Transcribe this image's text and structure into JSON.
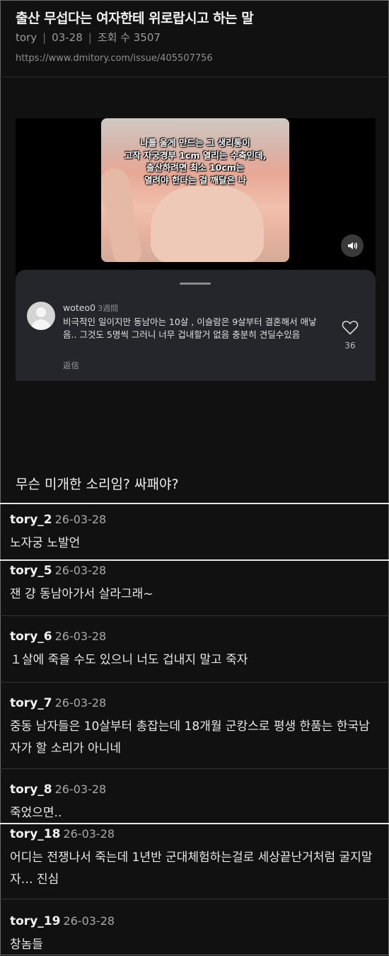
{
  "post": {
    "title": "출산 무섭다는 여자한테 위로랍시고 하는 말",
    "author": "tory",
    "date": "03-28",
    "views": "조회 수 3507",
    "url": "https://www.dmitory.com/issue/405507756"
  },
  "embed": {
    "caption_lines": [
      "나를 울게 만드는 그 생리통이",
      "고작 자궁경부 1cm 열리는 수축인데,",
      "출산하려면 최소 10cm는",
      "열려야 한다는 걸 깨달은 나"
    ],
    "sound_icon": "speaker-icon",
    "comment": {
      "username": "woteo0",
      "age": "3週間",
      "text": "비극적인 일이지만 동남아는 10살 , 이슬람은 9살부터 결혼해서 애낳음.. 그것도 5명씩 그러니 너무 겁내할거 없음 충분히 견딜수있음",
      "reply_label": "返信",
      "like_icon": "heart-outline-icon",
      "likes": "36"
    }
  },
  "body_text": "무슨 미개한 소리임? 싸패야?",
  "comments": [
    {
      "user": "tory_2",
      "date": "26-03-28",
      "text": "노자궁 노발언"
    },
    {
      "user": "tory_5",
      "date": "26-03-28",
      "text": "잰 걍 동남아가서 살라그래~"
    },
    {
      "user": "tory_6",
      "date": "26-03-28",
      "text": "１살에 죽을 수도 있으니 너도 겁내지 말고 죽자"
    },
    {
      "user": "tory_7",
      "date": "26-03-28",
      "text": "중동 남자들은 10살부터 총잡는데 18개월 군캉스로 평생 한품는 한국남자가 할 소리가 아니네"
    },
    {
      "user": "tory_8",
      "date": "26-03-28",
      "text": "죽었으면.."
    },
    {
      "user": "tory_18",
      "date": "26-03-28",
      "text": "어디는 전쟁나서 죽는데 1년반 군대체험하는걸로 세상끝난거처럼 굴지말자… 진심"
    },
    {
      "user": "tory_19",
      "date": "26-03-28",
      "text": "창놈들"
    }
  ]
}
